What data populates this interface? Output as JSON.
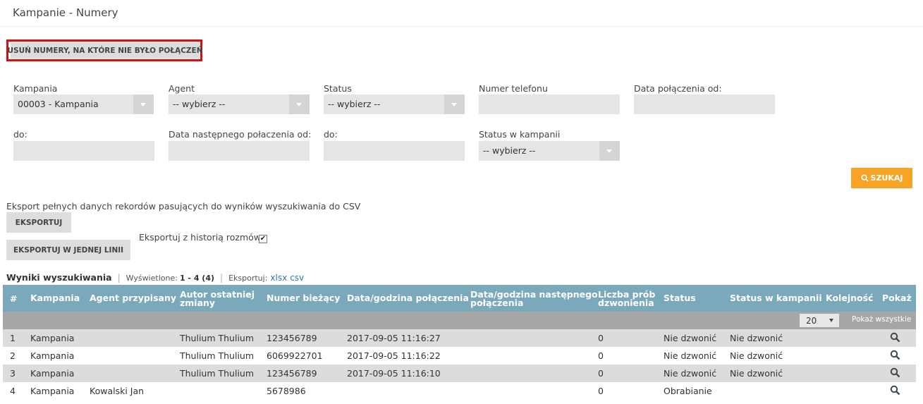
{
  "page": {
    "title": "Kampanie - Numery"
  },
  "actions": {
    "remove_label": "USUŃ NUMERY, NA KTÓRE NIE BYŁO POŁĄCZEŃ"
  },
  "filters": {
    "campaign_label": "Kampania",
    "campaign_value": "00003 - Kampania",
    "agent_label": "Agent",
    "agent_value": "-- wybierz --",
    "status_label": "Status",
    "status_value": "-- wybierz --",
    "phone_label": "Numer telefonu",
    "phone_value": "",
    "date_from_label": "Data połączenia od:",
    "date_from_value": "",
    "date_to_label": "do:",
    "date_to_value": "",
    "next_from_label": "Data następnego połaczenia od:",
    "next_from_value": "",
    "next_to_label": "do:",
    "next_to_value": "",
    "campaign_status_label": "Status w kampanii",
    "campaign_status_value": "-- wybierz --",
    "search_label": "SZUKAJ"
  },
  "export": {
    "description": "Eksport pełnych danych rekordów pasujących do wyników wyszukiwania do CSV",
    "export_label": "EKSPORTUJ",
    "export_line_label": "EKSPORTUJ W JEDNEJ LINII",
    "history_label": "Eksportuj z historią rozmów",
    "history_checked": true
  },
  "results": {
    "title": "Wyniki wyszukiwania",
    "shown_label": "Wyświetlone:",
    "shown_value": "1 - 4 (4)",
    "export_label": "Eksportuj:",
    "xlsx": "xlsx",
    "csv": "csv"
  },
  "table": {
    "columns": {
      "num": "#",
      "campaign": "Kampania",
      "agent": "Agent przypisany",
      "author_1": "Autor ostatniej",
      "author_2": "zmiany",
      "number": "Numer bieżący",
      "datetime": "Data/godzina połączenia",
      "next_1": "Data/godzina następnego",
      "next_2": "połączenia",
      "attempts_1": "Liczba prób",
      "attempts_2": "dzwonienia",
      "status": "Status",
      "camp_status": "Status w kampanii",
      "order": "Kolejność",
      "show": "Pokaż"
    },
    "page_size": "20",
    "show_all": "Pokaż wszystkie",
    "rows": [
      {
        "num": "1",
        "campaign": "Kampania",
        "agent": "",
        "author": "Thulium Thulium",
        "number": "123456789",
        "datetime": "2017-09-05 11:16:27",
        "next": "",
        "attempts": "0",
        "status": "Nie dzwonić",
        "camp_status": "Nie dzwonić",
        "order": ""
      },
      {
        "num": "2",
        "campaign": "Kampania",
        "agent": "",
        "author": "Thulium Thulium",
        "number": "6069922701",
        "datetime": "2017-09-05 11:16:22",
        "next": "",
        "attempts": "0",
        "status": "Nie dzwonić",
        "camp_status": "Nie dzwonić",
        "order": ""
      },
      {
        "num": "3",
        "campaign": "Kampania",
        "agent": "",
        "author": "Thulium Thulium",
        "number": "123456789",
        "datetime": "2017-09-05 11:16:10",
        "next": "",
        "attempts": "0",
        "status": "Nie dzwonić",
        "camp_status": "Nie dzwonić",
        "order": ""
      },
      {
        "num": "4",
        "campaign": "Kampania",
        "agent": "Kowalski Jan",
        "author": "",
        "number": "5678986",
        "datetime": "",
        "next": "",
        "attempts": "0",
        "status": "Obrabianie",
        "camp_status": "",
        "order": ""
      }
    ]
  },
  "colors": {
    "header_bg": "#7aa9bb",
    "accent_orange": "#f7a325",
    "highlight_red": "#d50f0f"
  }
}
